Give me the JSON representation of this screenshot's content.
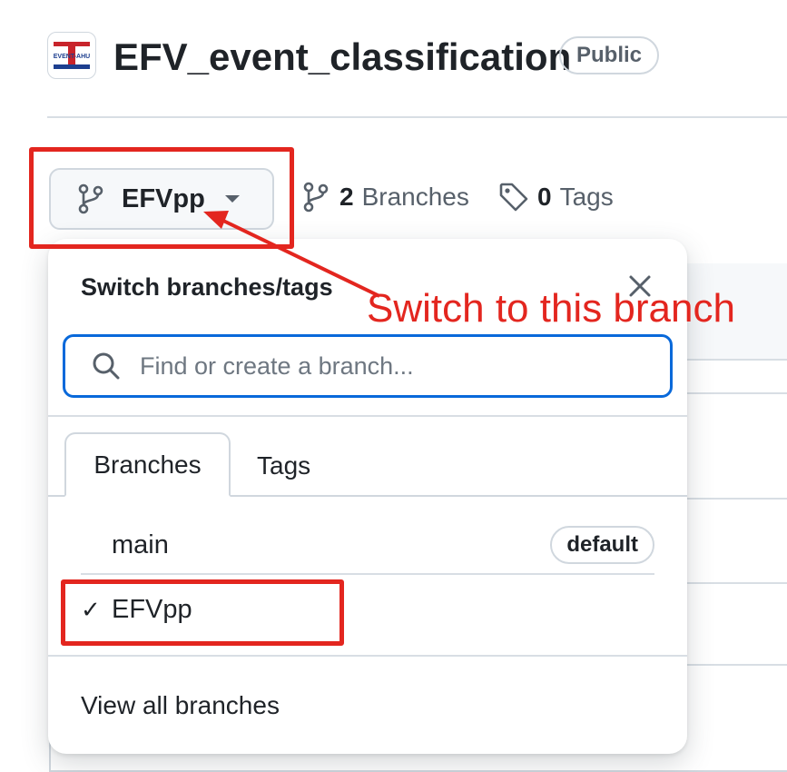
{
  "repo": {
    "name": "EFV_event_classification",
    "visibility": "Public",
    "logo_text": "EVENT-AHU"
  },
  "branch_selector": {
    "current_branch": "EFVpp"
  },
  "stats": {
    "branches_count": "2",
    "branches_label": "Branches",
    "tags_count": "0",
    "tags_label": "Tags"
  },
  "dropdown": {
    "title": "Switch branches/tags",
    "search_placeholder": "Find or create a branch...",
    "tabs": [
      {
        "label": "Branches",
        "active": true
      },
      {
        "label": "Tags",
        "active": false
      }
    ],
    "branches": [
      {
        "name": "main",
        "badge": "default",
        "selected": false
      },
      {
        "name": "EFVpp",
        "badge": "",
        "selected": true,
        "check": "✓"
      }
    ],
    "view_all": "View all branches"
  },
  "annotation": {
    "text": "Switch to this branch",
    "color": "#e3261f"
  },
  "colors": {
    "accent": "#0969da",
    "border": "#d0d7de",
    "muted": "#57606a"
  }
}
